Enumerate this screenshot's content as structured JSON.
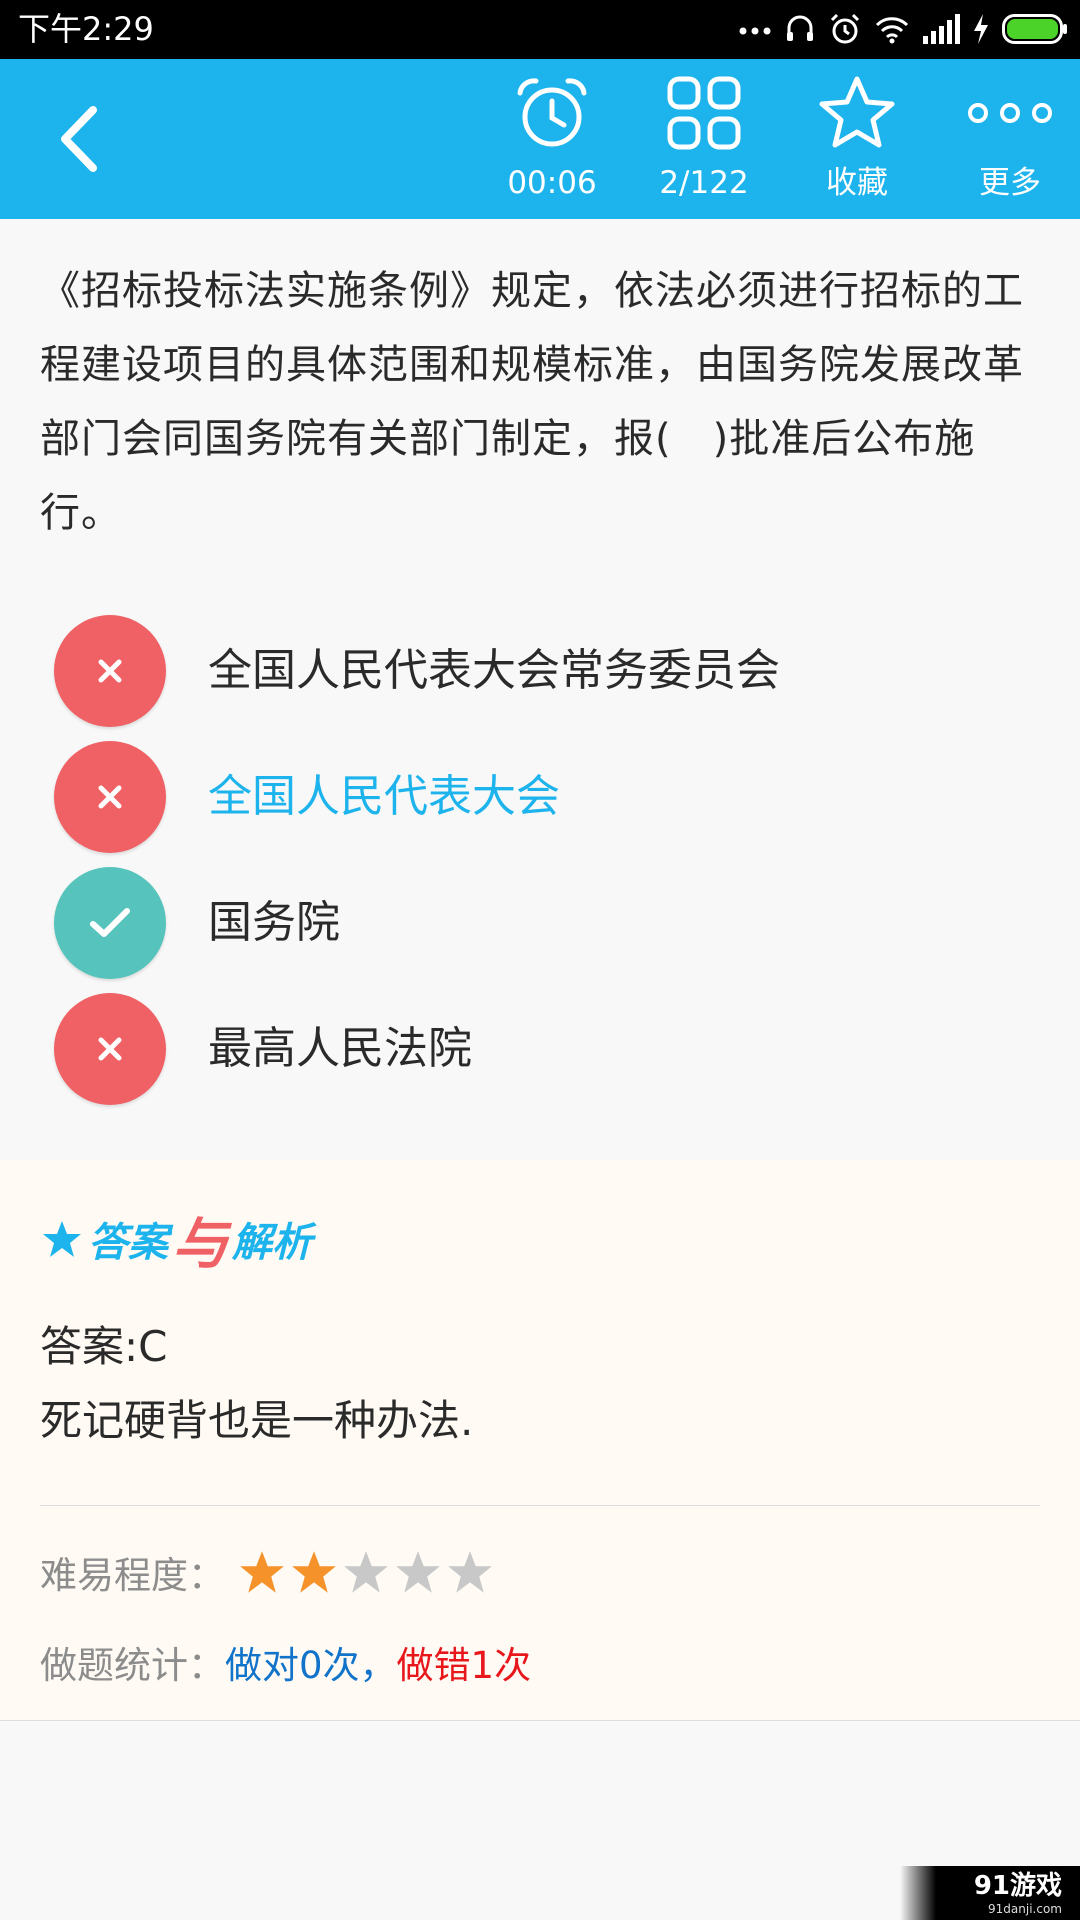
{
  "status_bar": {
    "time": "下午2:29",
    "icons": [
      "more-dots-icon",
      "headset-icon",
      "alarm-icon",
      "wifi-icon",
      "signal-icon",
      "charging-icon",
      "battery-icon"
    ],
    "battery_color": "#4cd32a"
  },
  "app_bar": {
    "background": "#1db3ec",
    "timer": "00:06",
    "progress": "2/122",
    "favorite_label": "收藏",
    "more_label": "更多"
  },
  "question": {
    "text": "《招标投标法实施条例》规定，依法必须进行招标的工程建设项目的具体范围和规模标准，由国务院发展改革部门会同国务院有关部门制定，报(　)批准后公布施行。"
  },
  "options": [
    {
      "text": "全国人民代表大会常务委员会",
      "state": "wrong",
      "selected": false
    },
    {
      "text": "全国人民代表大会",
      "state": "wrong",
      "selected": true
    },
    {
      "text": "国务院",
      "state": "right",
      "selected": false
    },
    {
      "text": "最高人民法院",
      "state": "wrong",
      "selected": false
    }
  ],
  "analysis": {
    "title_left": "答案",
    "title_mid": "与",
    "title_right": "解析",
    "answer": "答案:C",
    "explanation": "死记硬背也是一种办法.",
    "difficulty_label": "难易程度：",
    "difficulty_rating": 2,
    "difficulty_max": 5,
    "stats_label": "做题统计：",
    "stats_right": "做对0次",
    "stats_sep": "，",
    "stats_wrong": "做错1次"
  },
  "colors": {
    "wrong": "#f06165",
    "right": "#56c4bc",
    "star_on": "#f5922a",
    "star_off": "#c8c8c8"
  },
  "watermark": {
    "main": "91游戏",
    "sub": "91danji.com"
  }
}
